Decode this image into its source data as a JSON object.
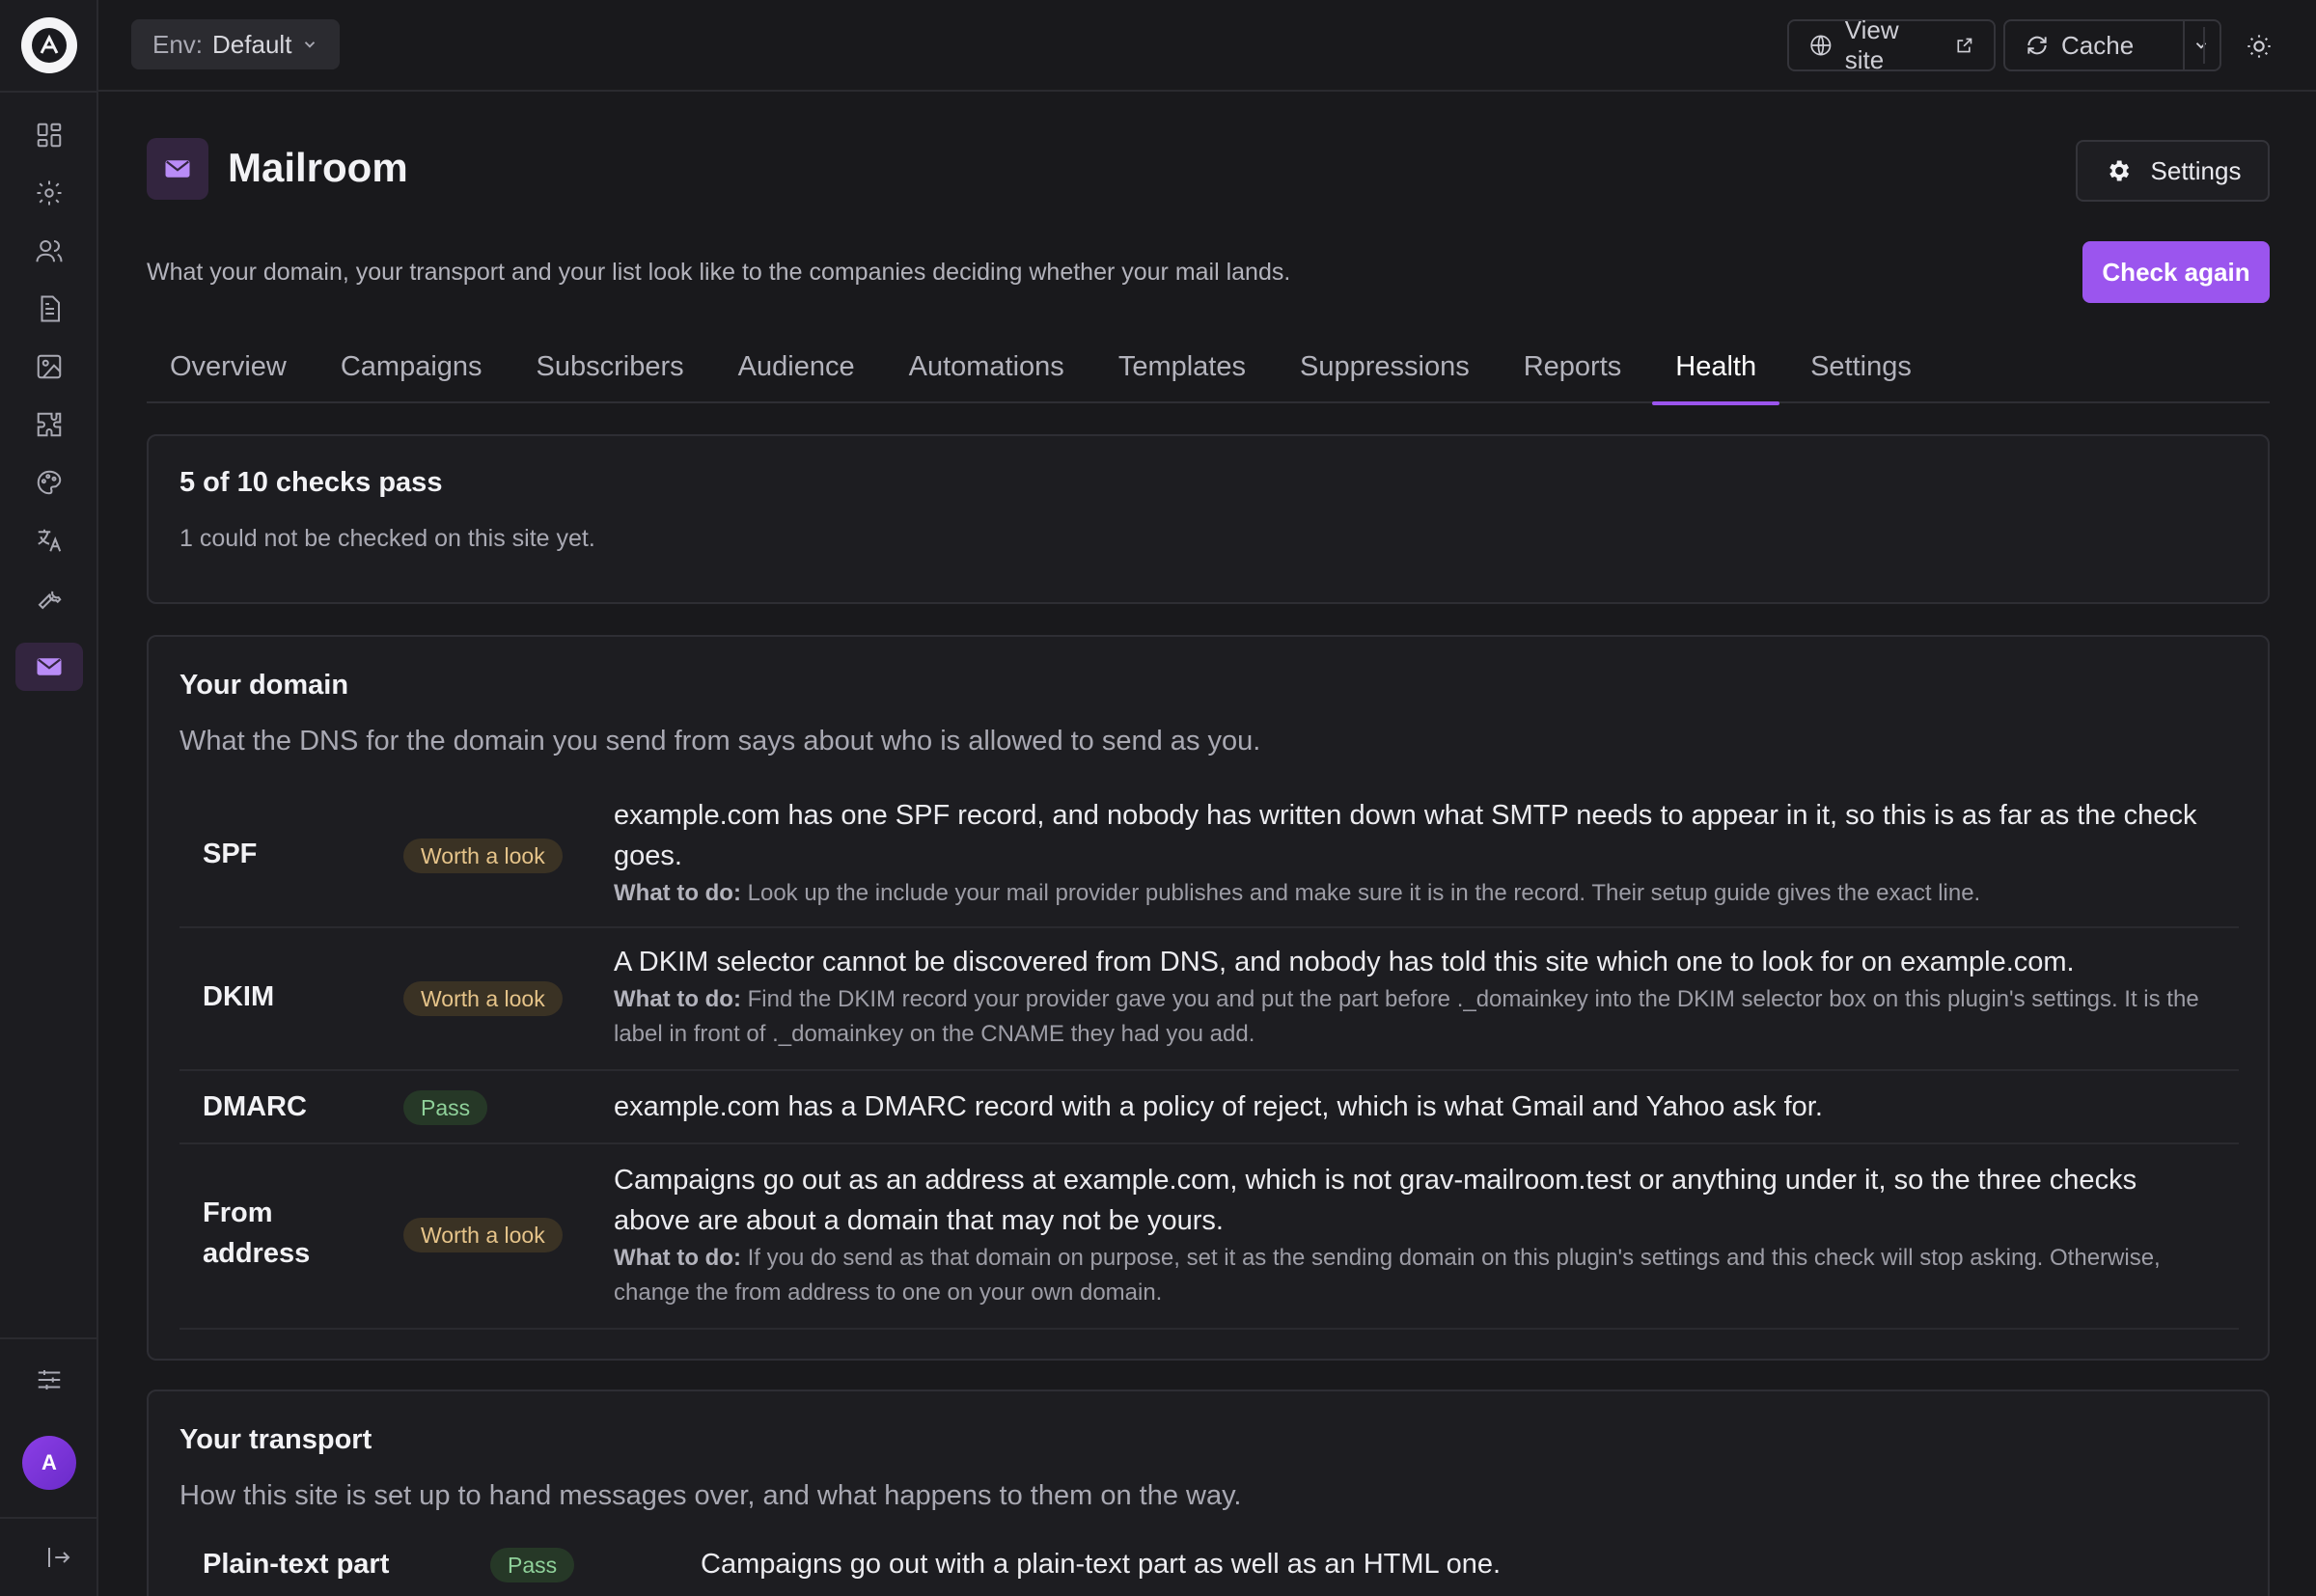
{
  "topbar": {
    "env_label": "Env:",
    "env_value": "Default",
    "view_site": "View site",
    "cache": "Cache"
  },
  "header": {
    "title": "Mailroom",
    "settings_label": "Settings",
    "subtitle": "What your domain, your transport and your list look like to the companies deciding whether your mail lands.",
    "check_again": "Check again"
  },
  "tabs": [
    "Overview",
    "Campaigns",
    "Subscribers",
    "Audience",
    "Automations",
    "Templates",
    "Suppressions",
    "Reports",
    "Health",
    "Settings"
  ],
  "active_tab": "Health",
  "summary": {
    "title": "5 of 10 checks pass",
    "note": "1 could not be checked on this site yet."
  },
  "domain": {
    "title": "Your domain",
    "subtitle": "What the DNS for the domain you send from says about who is allowed to send as you.",
    "todo_label": "What to do:",
    "rows": [
      {
        "label": "SPF",
        "status": "Worth a look",
        "text": "example.com has one SPF record, and nobody has written down what SMTP needs to appear in it, so this is as far as the check goes.",
        "todo": "Look up the include your mail provider publishes and make sure it is in the record. Their setup guide gives the exact line."
      },
      {
        "label": "DKIM",
        "status": "Worth a look",
        "text": "A DKIM selector cannot be discovered from DNS, and nobody has told this site which one to look for on example.com.",
        "todo": "Find the DKIM record your provider gave you and put the part before ._domainkey into the DKIM selector box on this plugin's settings. It is the label in front of ._domainkey on the CNAME they had you add."
      },
      {
        "label": "DMARC",
        "status": "Pass",
        "text": "example.com has a DMARC record with a policy of reject, which is what Gmail and Yahoo ask for."
      },
      {
        "label": "From address",
        "status": "Worth a look",
        "text": "Campaigns go out as an address at example.com, which is not grav-mailroom.test or anything under it, so the three checks above are about a domain that may not be yours.",
        "todo": "If you do send as that domain on purpose, set it as the sending domain on this plugin's settings and this check will stop asking. Otherwise, change the from address to one on your own domain."
      }
    ]
  },
  "transport": {
    "title": "Your transport",
    "subtitle": "How this site is set up to hand messages over, and what happens to them on the way.",
    "rows": [
      {
        "label": "Plain-text part",
        "status": "Pass",
        "text": "Campaigns go out with a plain-text part as well as an HTML one."
      }
    ]
  },
  "sidebar": {
    "icons": [
      "dashboard-icon",
      "gear-icon",
      "users-icon",
      "pages-icon",
      "media-icon",
      "plugins-icon",
      "themes-icon",
      "translate-icon",
      "tools-icon",
      "mail-icon"
    ],
    "avatar_initial": "A"
  },
  "colors": {
    "accent": "#9b55ee",
    "warn_badge": "#3a3224",
    "pass_badge": "#263827"
  }
}
